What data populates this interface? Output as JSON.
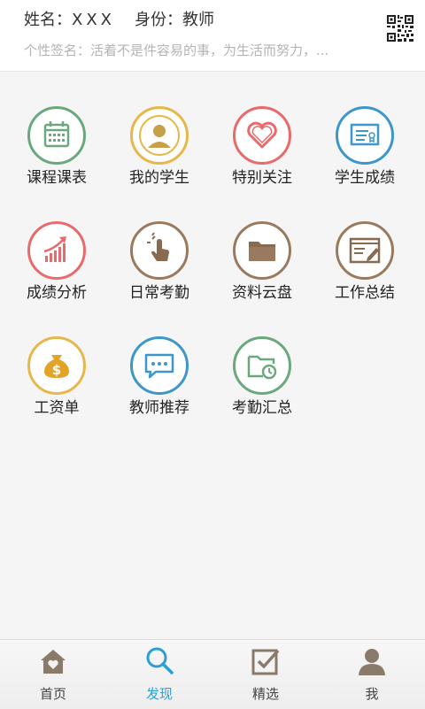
{
  "header": {
    "name_label": "姓名：",
    "name_value": "XXX",
    "role_label": "身份：",
    "role_value": "教师",
    "signature": "个性签名：活着不是件容易的事，为生活而努力，..."
  },
  "colors": {
    "green": "#6aa87e",
    "gold": "#e6b84a",
    "red": "#e86a6a",
    "blue": "#3d97c8",
    "brown": "#9a7a5e",
    "active_nav": "#2a9fd6"
  },
  "grid": {
    "items": [
      {
        "label": "课程课表",
        "icon": "calendar-icon",
        "color": "green"
      },
      {
        "label": "我的学生",
        "icon": "student-icon",
        "color": "gold"
      },
      {
        "label": "特别关注",
        "icon": "heart-icon",
        "color": "red"
      },
      {
        "label": "学生成绩",
        "icon": "certificate-icon",
        "color": "blue"
      },
      {
        "label": "成绩分析",
        "icon": "bar-chart-icon",
        "color": "red"
      },
      {
        "label": "日常考勤",
        "icon": "hand-tap-icon",
        "color": "brown"
      },
      {
        "label": "资料云盘",
        "icon": "folder-icon",
        "color": "brown"
      },
      {
        "label": "工作总结",
        "icon": "edit-window-icon",
        "color": "brown"
      },
      {
        "label": "工资单",
        "icon": "money-bag-icon",
        "color": "gold"
      },
      {
        "label": "教师推荐",
        "icon": "chat-bubble-icon",
        "color": "blue"
      },
      {
        "label": "考勤汇总",
        "icon": "folder-clock-icon",
        "color": "green"
      }
    ]
  },
  "bottom_nav": {
    "items": [
      {
        "label": "首页",
        "icon": "home-icon",
        "active": false
      },
      {
        "label": "发现",
        "icon": "search-icon",
        "active": true
      },
      {
        "label": "精选",
        "icon": "checkbox-icon",
        "active": false
      },
      {
        "label": "我",
        "icon": "user-icon",
        "active": false
      }
    ]
  }
}
